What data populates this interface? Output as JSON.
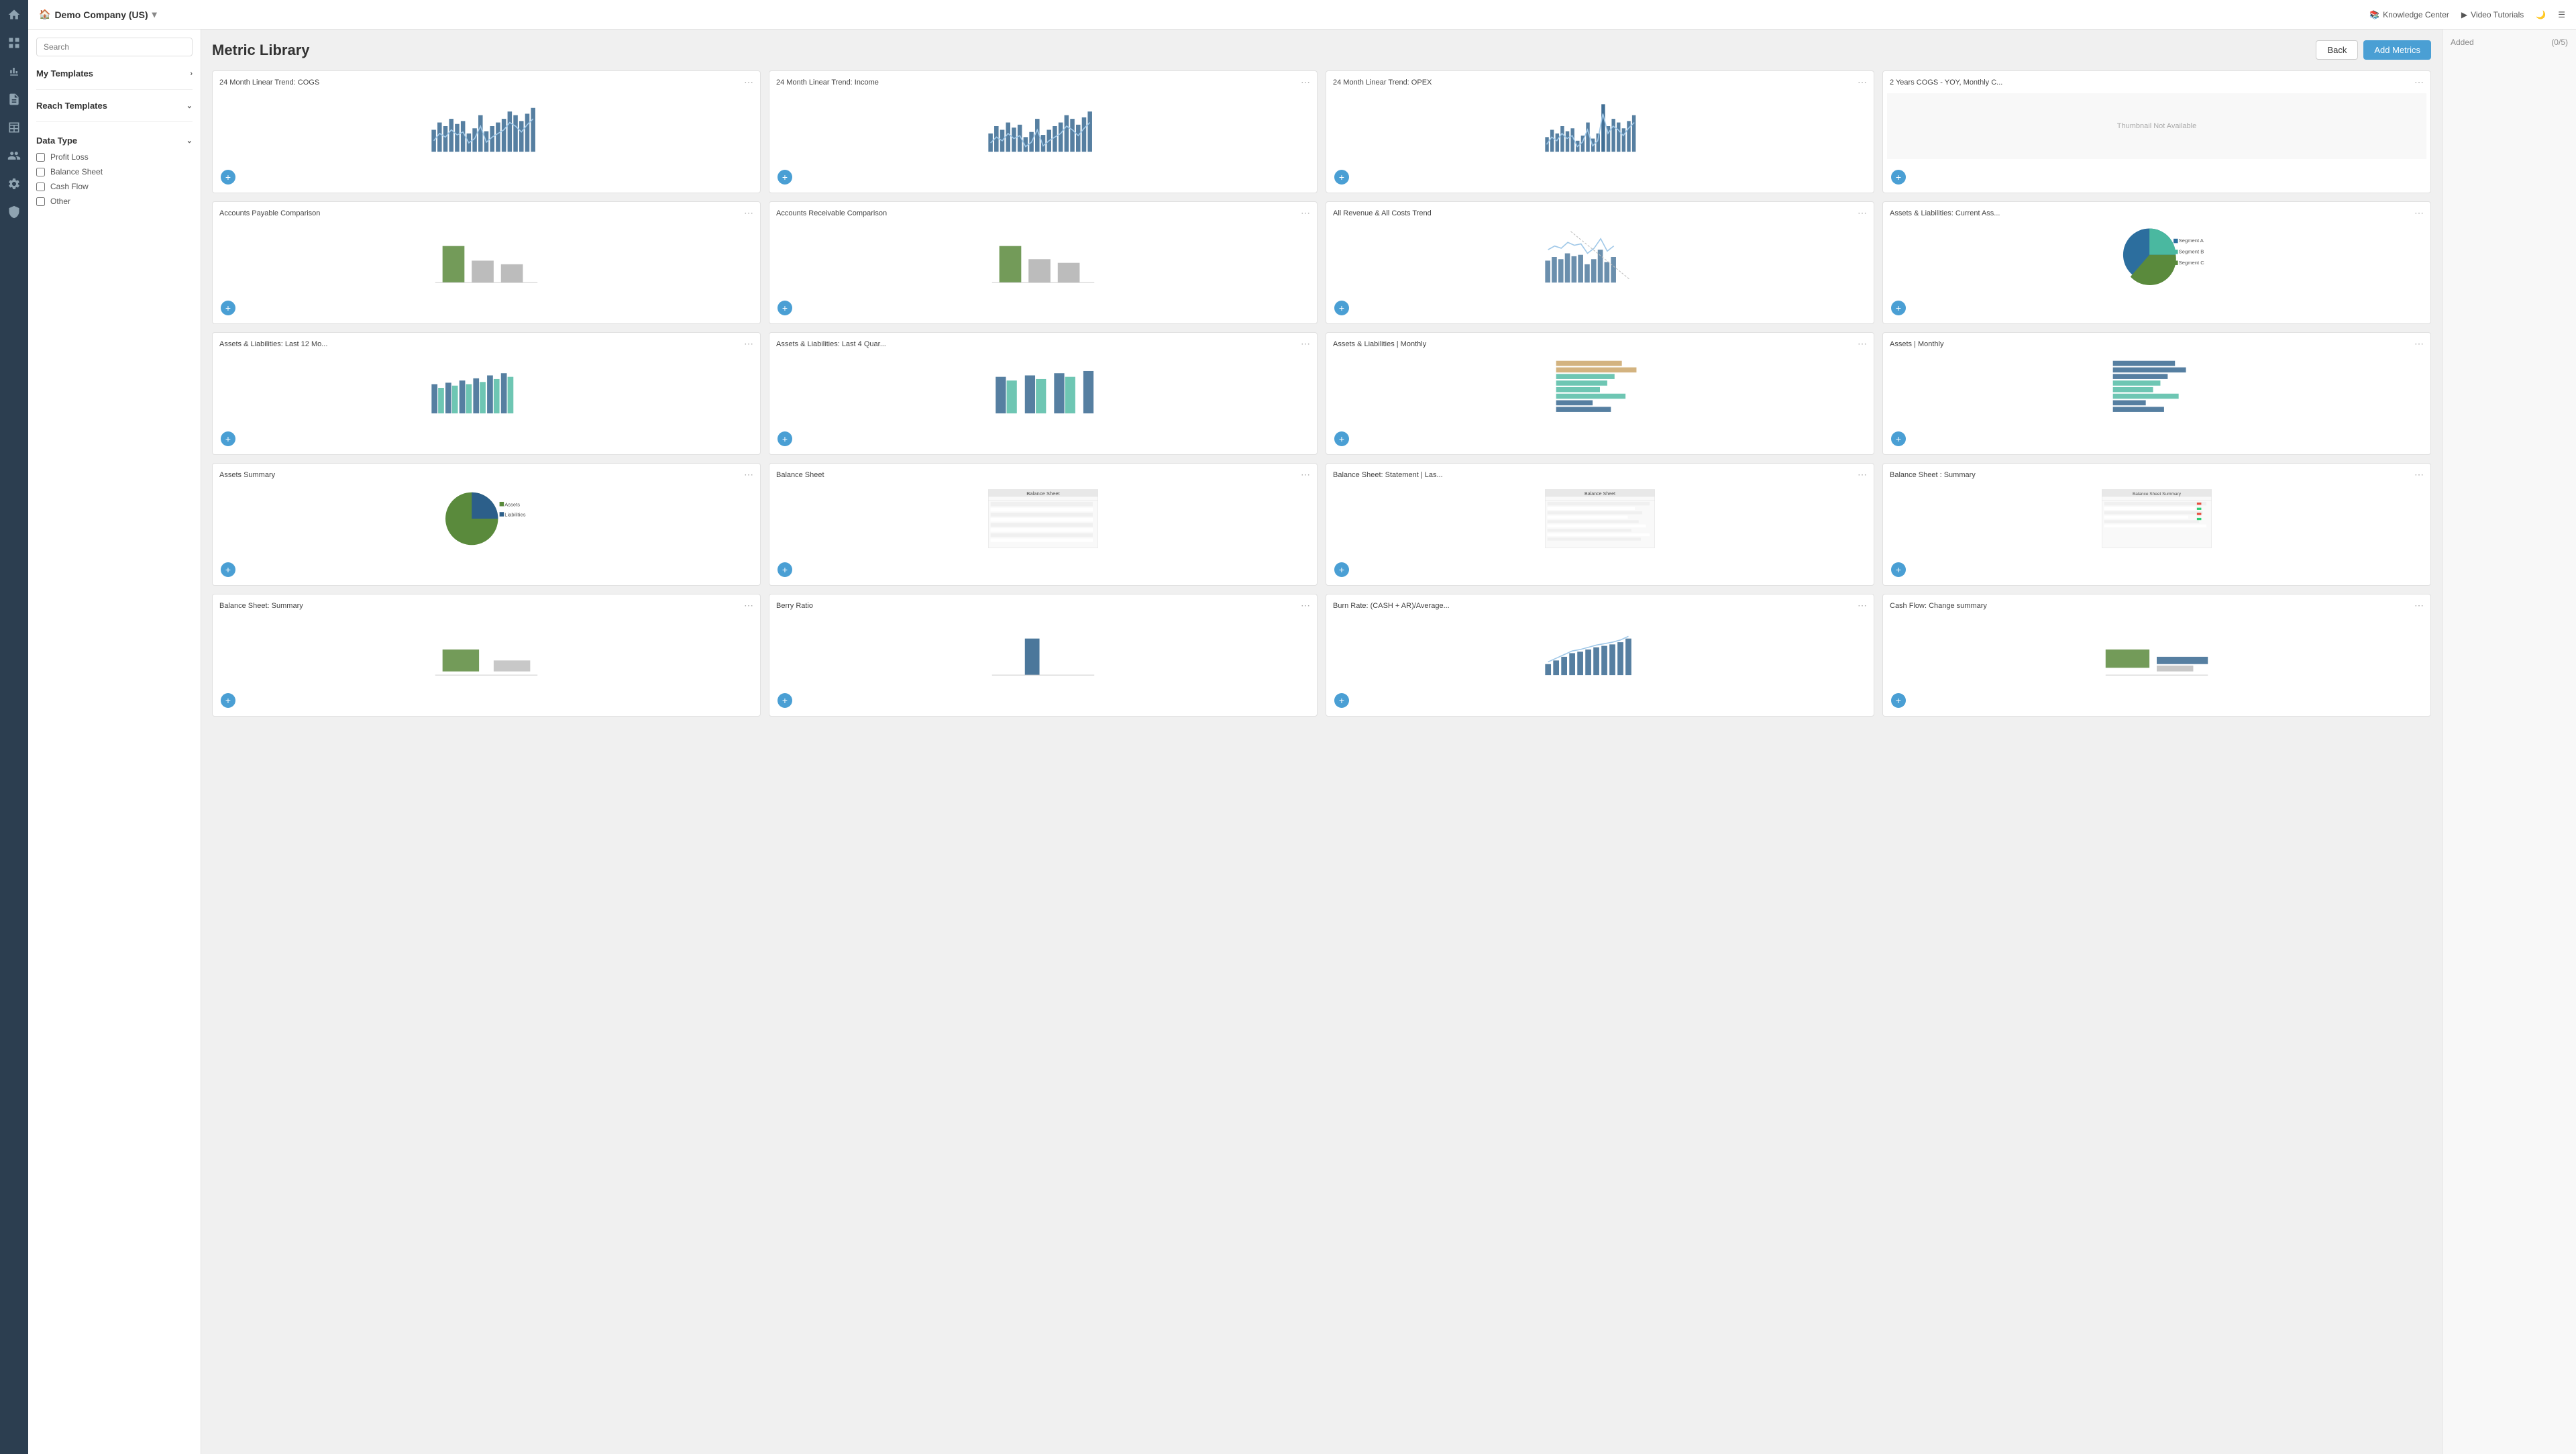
{
  "sidebar": {
    "icons": [
      "grid",
      "chart-bar",
      "document",
      "table",
      "users",
      "gear",
      "shield"
    ]
  },
  "topbar": {
    "company": "Demo Company (US)",
    "dropdown_icon": "▾",
    "nav_items": [
      {
        "label": "Knowledge Center",
        "icon": "book"
      },
      {
        "label": "Video Tutorials",
        "icon": "video"
      },
      {
        "label": "dark-mode",
        "icon": "moon"
      },
      {
        "label": "menu",
        "icon": "hamburger"
      }
    ]
  },
  "page": {
    "title": "Metric Library",
    "back_label": "Back",
    "add_metrics_label": "Add Metrics"
  },
  "left_panel": {
    "search_placeholder": "Search",
    "my_templates_label": "My Templates",
    "reach_templates_label": "Reach Templates",
    "data_type_label": "Data Type",
    "filters": [
      {
        "label": "Profit Loss"
      },
      {
        "label": "Balance Sheet"
      },
      {
        "label": "Cash Flow"
      },
      {
        "label": "Other"
      }
    ]
  },
  "right_panel": {
    "added_label": "Added",
    "count": "(0/5)"
  },
  "metrics": [
    {
      "title": "24 Month Linear Trend: COGS",
      "type": "bar_line"
    },
    {
      "title": "24 Month Linear Trend: Income",
      "type": "bar_line"
    },
    {
      "title": "24 Month Linear Trend: OPEX",
      "type": "bar_line_small"
    },
    {
      "title": "2 Years COGS - YOY, Monthly C...",
      "type": "thumbnail_not_available"
    },
    {
      "title": "Accounts Payable Comparison",
      "type": "bar_comparison"
    },
    {
      "title": "Accounts Receivable Comparison",
      "type": "bar_comparison2"
    },
    {
      "title": "All Revenue & All Costs Trend",
      "type": "bar_line2"
    },
    {
      "title": "Assets & Liabilities: Current Ass...",
      "type": "pie"
    },
    {
      "title": "Assets & Liabilities: Last 12 Mo...",
      "type": "bar_grouped"
    },
    {
      "title": "Assets & Liabilities: Last 4 Quar...",
      "type": "bar_grouped2"
    },
    {
      "title": "Assets & Liabilities | Monthly",
      "type": "bar_horizontal"
    },
    {
      "title": "Assets | Monthly",
      "type": "bar_horizontal2"
    },
    {
      "title": "Assets Summary",
      "type": "pie2"
    },
    {
      "title": "Balance Sheet",
      "type": "table_sheet"
    },
    {
      "title": "Balance Sheet: Statement | Las...",
      "type": "table_sheet2"
    },
    {
      "title": "Balance Sheet : Summary",
      "type": "table_summary"
    },
    {
      "title": "Balance Sheet: Summary",
      "type": "bar_balance"
    },
    {
      "title": "Berry Ratio",
      "type": "bar_berry"
    },
    {
      "title": "Burn Rate: (CASH + AR)/Average...",
      "type": "bar_burn"
    },
    {
      "title": "Cash Flow: Change summary",
      "type": "bar_cashflow"
    }
  ]
}
